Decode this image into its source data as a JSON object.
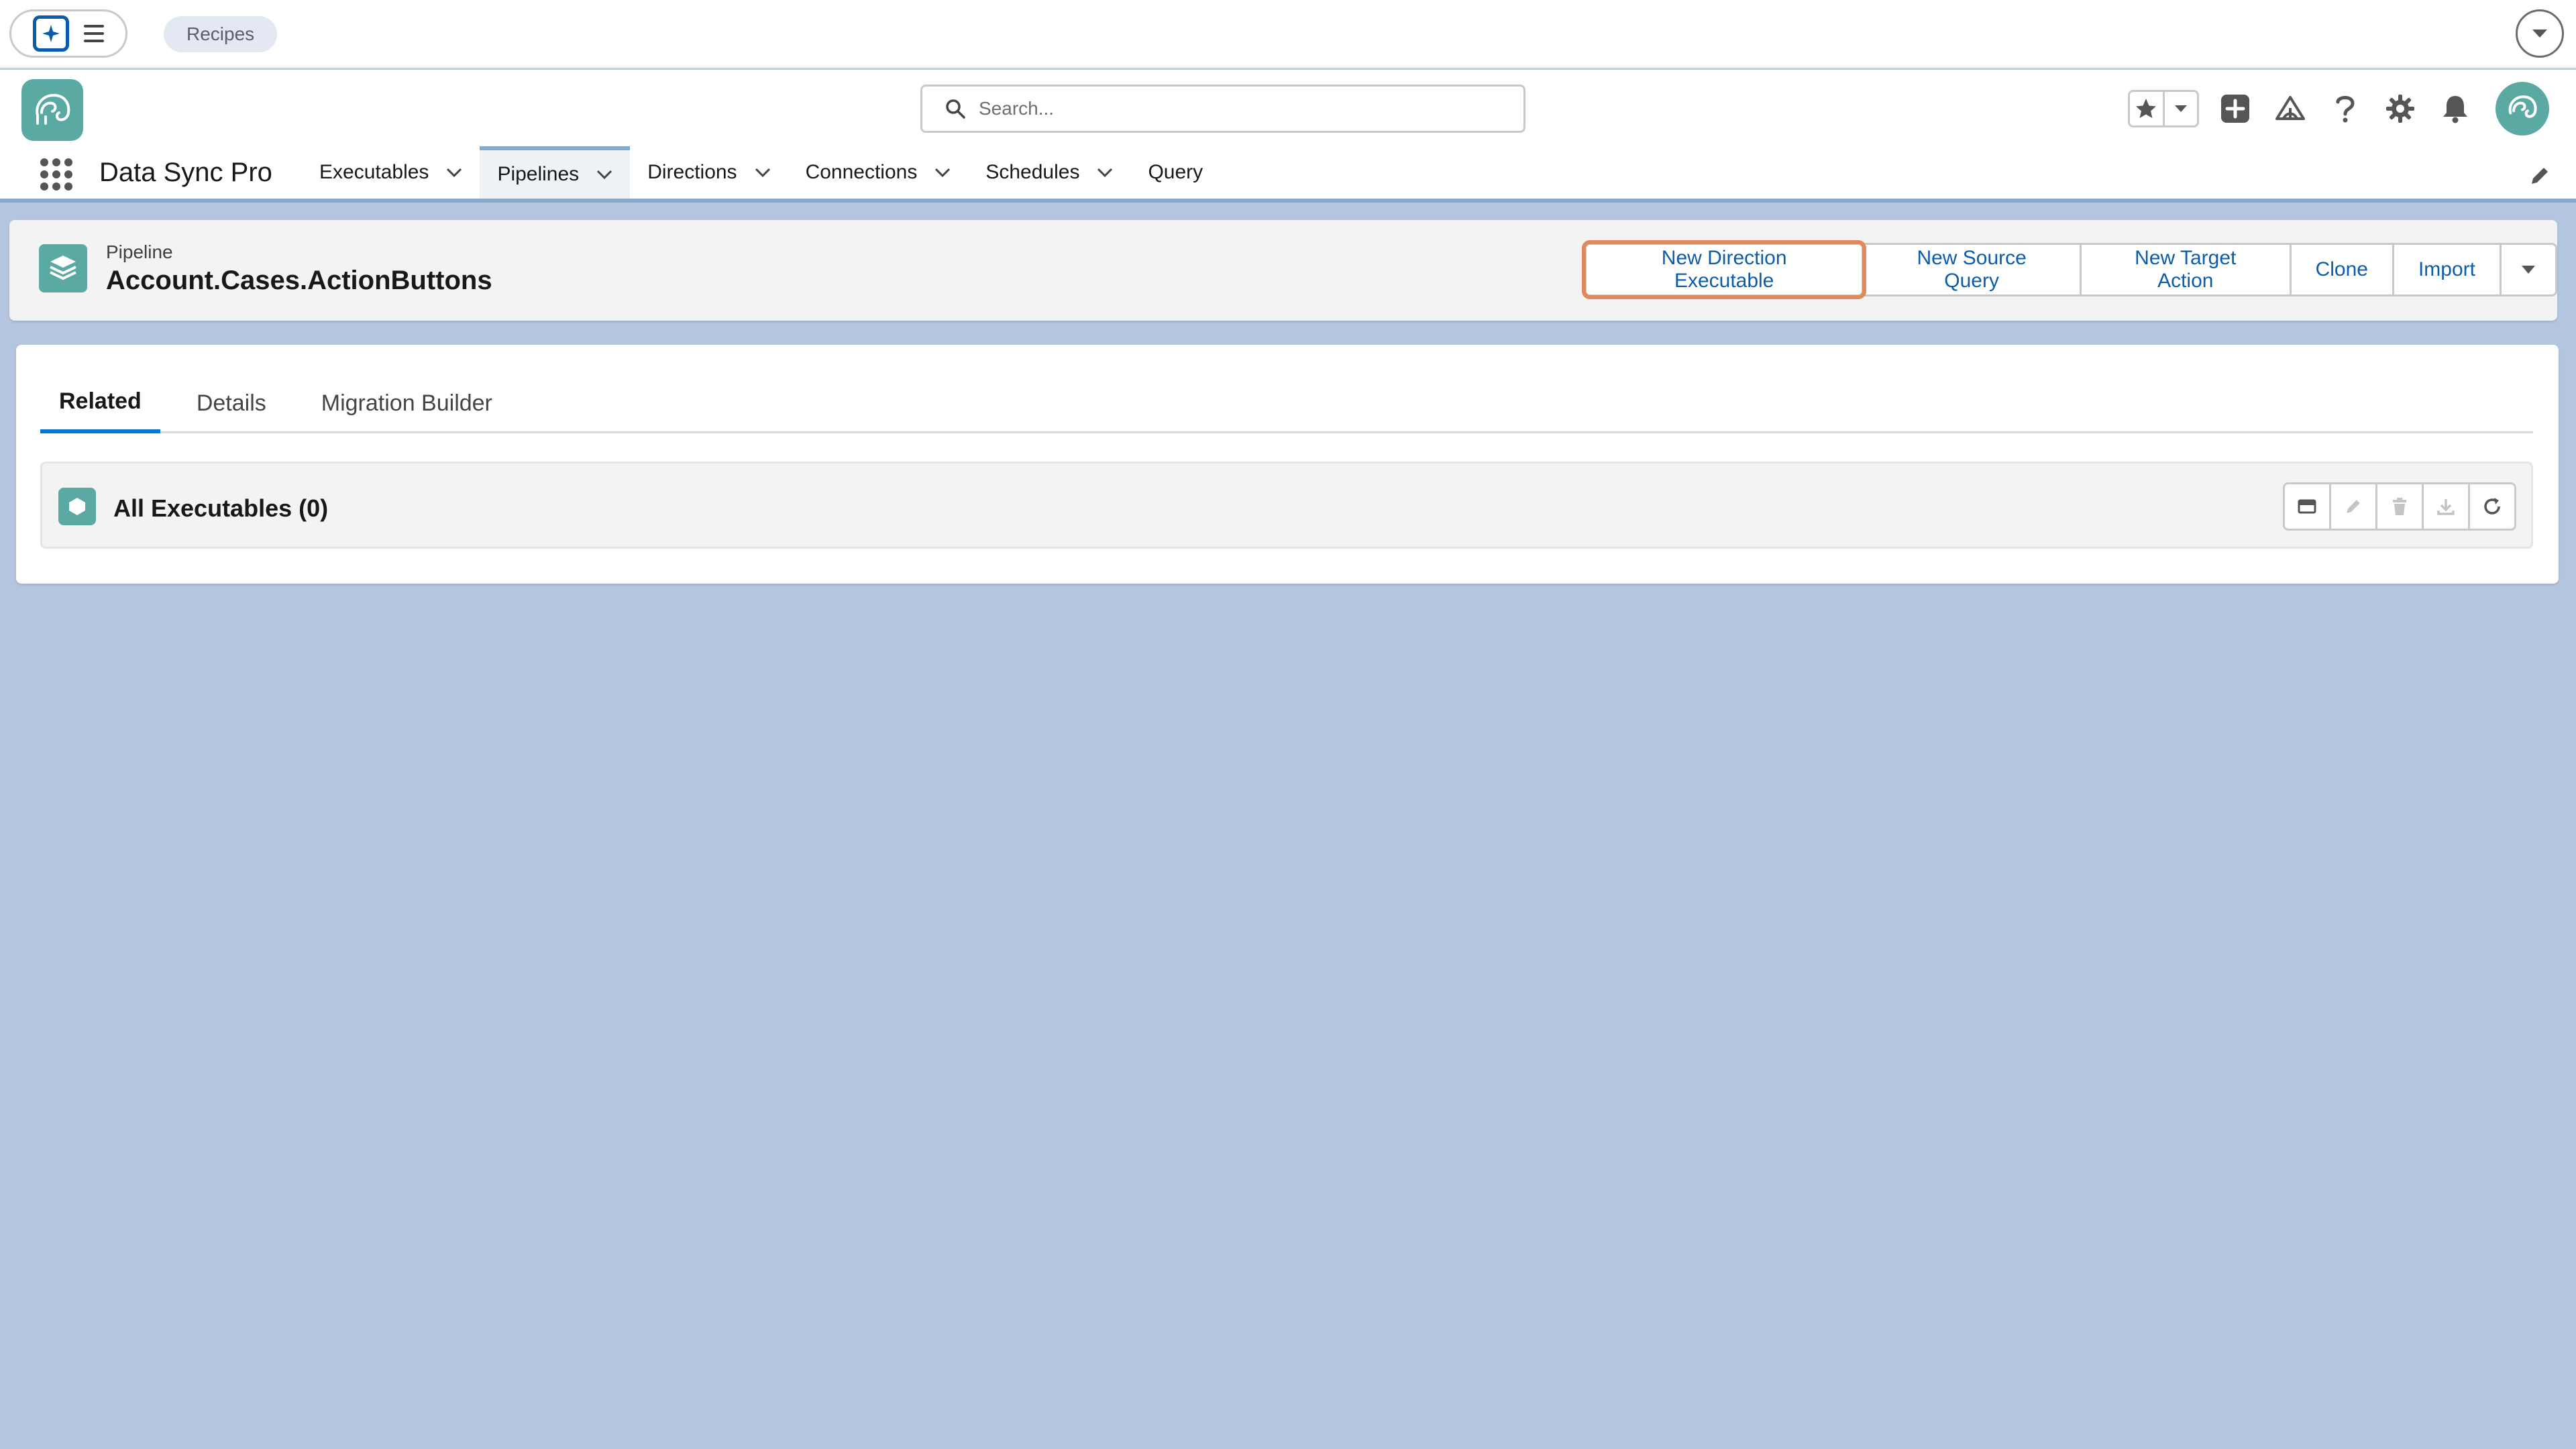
{
  "utility_bar": {
    "chip_label": "Recipes"
  },
  "header": {
    "search_placeholder": "Search..."
  },
  "nav": {
    "app_name": "Data Sync Pro",
    "items": [
      {
        "label": "Executables",
        "has_menu": true,
        "active": false
      },
      {
        "label": "Pipelines",
        "has_menu": true,
        "active": true
      },
      {
        "label": "Directions",
        "has_menu": true,
        "active": false
      },
      {
        "label": "Connections",
        "has_menu": true,
        "active": false
      },
      {
        "label": "Schedules",
        "has_menu": true,
        "active": false
      },
      {
        "label": "Query",
        "has_menu": false,
        "active": false
      }
    ]
  },
  "record": {
    "type_label": "Pipeline",
    "title": "Account.Cases.ActionButtons",
    "actions": {
      "new_direction_executable": "New Direction Executable",
      "new_source_query": "New Source Query",
      "new_target_action": "New Target Action",
      "clone": "Clone",
      "import": "Import"
    }
  },
  "tabs": {
    "related": "Related",
    "details": "Details",
    "migration_builder": "Migration Builder",
    "active": "Related"
  },
  "related_list": {
    "title": "All Executables (0)"
  },
  "colors": {
    "brand_teal": "#5aa9a3",
    "link_blue": "#0b5cab",
    "focus_orange": "#e0895a",
    "page_background": "#b4c5df",
    "active_tab_underline": "#0176d3"
  }
}
